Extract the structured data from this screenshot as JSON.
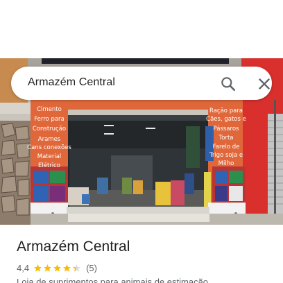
{
  "search": {
    "query": "Armazém Central"
  },
  "place": {
    "name": "Armazém Central",
    "rating": "4,4",
    "stars_fraction": 0.88,
    "review_count": "(5)",
    "category": "Loja de suprimentos para animais de estimação"
  },
  "storefront": {
    "left_sign": [
      "Cimento",
      "Ferro para",
      "Construção",
      "Arames",
      "Cans conexões",
      "Material",
      "Elétrico"
    ],
    "right_sign": [
      "Ração para",
      "Cães, gatos e",
      "Pássaros",
      "Torta",
      "Farelo de",
      "Trigo soja e",
      "Milho"
    ]
  },
  "colors": {
    "accent_star": "#fbbc04",
    "text_primary": "#202124",
    "text_secondary": "#5f6368",
    "wall_orange": "#e0673a",
    "wall_red": "#d9302d"
  },
  "icons": {
    "search": "search-icon",
    "close": "close-icon",
    "star": "star-icon"
  }
}
